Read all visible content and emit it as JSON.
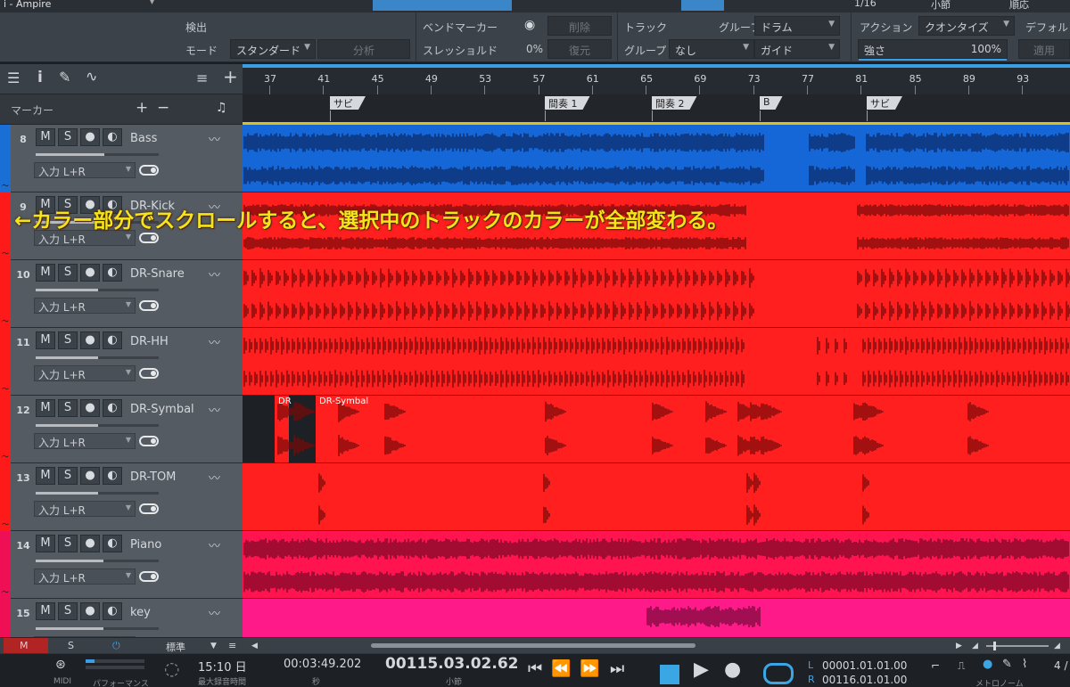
{
  "top_strip": {
    "title": "i - Ampire",
    "grid_value": "1/16",
    "timebase": "小節",
    "mode": "順応"
  },
  "inspector": {
    "detect_label": "検出",
    "mode_label": "モード",
    "mode_value": "スタンダード",
    "analyze_btn": "分析",
    "bend_marker_label": "ベンドマーカー",
    "delete_btn": "削除",
    "threshold_label": "スレッショルド",
    "threshold_value": "0%",
    "restore_btn": "復元",
    "track_label": "トラック",
    "group_label": "グループ",
    "group_value": "ドラム",
    "group2_label": "グループ",
    "group2_value": "なし",
    "guide_value": "ガイド",
    "action_label": "アクション",
    "action_value": "クオンタイズ",
    "strength_label": "強さ",
    "strength_value": "100%",
    "default_label": "デフォル",
    "apply_btn": "適用"
  },
  "track_header": {
    "marker_label": "マーカー",
    "plus": "+",
    "minus": "−"
  },
  "tracks": [
    {
      "num": "8",
      "name": "Bass",
      "input": "入力 L+R",
      "color": "#1a6fd6",
      "fader": 0.56
    },
    {
      "num": "9",
      "name": "DR-Kick",
      "input": "入力 L+R",
      "color": "#ff1a1a",
      "fader": 0.56
    },
    {
      "num": "10",
      "name": "DR-Snare",
      "input": "入力 L+R",
      "color": "#ff1a1a",
      "fader": 0.51
    },
    {
      "num": "11",
      "name": "DR-HH",
      "input": "入力 L+R",
      "color": "#ff1a1a",
      "fader": 0.51
    },
    {
      "num": "12",
      "name": "DR-Symbal",
      "input": "入力 L+R",
      "color": "#ff1a1a",
      "fader": 0.51
    },
    {
      "num": "13",
      "name": "DR-TOM",
      "input": "入力 L+R",
      "color": "#ff1a1a",
      "fader": 0.51
    },
    {
      "num": "14",
      "name": "Piano",
      "input": "入力 L+R",
      "color": "#ee0f55",
      "fader": 0.55
    },
    {
      "num": "15",
      "name": "key",
      "input": "入力 L+R",
      "color": "#ee0f55",
      "fader": 0.55
    }
  ],
  "ruler": [
    "37",
    "41",
    "45",
    "49",
    "53",
    "57",
    "61",
    "65",
    "69",
    "73",
    "77",
    "81",
    "85",
    "89",
    "93"
  ],
  "markers": [
    {
      "label": "サビ"
    },
    {
      "label": "間奏 1"
    },
    {
      "label": "間奏 2"
    },
    {
      "label": "B"
    },
    {
      "label": "サビ"
    }
  ],
  "clips": {
    "symbal_short": "DR",
    "symbal_long": "DR-Symbal"
  },
  "annotation": "←カラー部分でスクロールすると、選択中のトラックのカラーが全部変わる。",
  "bottom_bar": {
    "m": "M",
    "s": "S",
    "preset": "標準"
  },
  "transport": {
    "midi": "MIDI",
    "perf": "パフォーマンス",
    "time": "15:10 日",
    "time_sub": "最大録音時間",
    "seconds": "00:03:49.202",
    "seconds_sub": "秒",
    "bars": "00115.03.02.62",
    "bars_sub": "小節",
    "loop_l": "00001.01.01.00",
    "loop_r": "00116.01.01.00",
    "l_label": "L",
    "r_label": "R",
    "metronome": "メトロノーム",
    "timesig": "4 /"
  }
}
